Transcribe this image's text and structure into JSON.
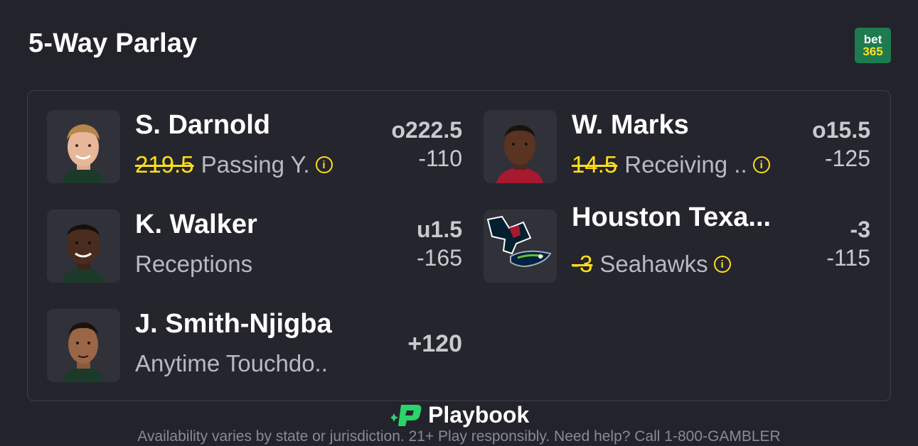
{
  "header": {
    "title": "5-Way Parlay",
    "logo_line1": "bet",
    "logo_line2": "365"
  },
  "legs": [
    {
      "player": "S. Darnold",
      "strike": "219.5",
      "market": "Passing Y.",
      "line": "o222.5",
      "odds": "-110",
      "avatar": "player-photo"
    },
    {
      "player": "W. Marks",
      "strike": "14.5",
      "market": "Receiving ..",
      "line": "o15.5",
      "odds": "-125",
      "avatar": "player-photo"
    },
    {
      "player": "K. Walker",
      "market": "Receptions",
      "line": "u1.5",
      "odds": "-165",
      "avatar": "player-photo"
    },
    {
      "player": "Houston Texa...",
      "strike": "-3",
      "market": "Seahawks",
      "line": "-3",
      "odds": "-115",
      "avatar": "team-logos"
    },
    {
      "player": "J. Smith-Njigba",
      "market": "Anytime Touchdo..",
      "odds": "+120",
      "avatar": "player-photo"
    }
  ],
  "footer": {
    "brand": "Playbook",
    "disclaimer": "Availability varies by state or jurisdiction. 21+ Play responsibly. Need help? Call 1-800-GAMBLER"
  },
  "colors": {
    "background": "#23232b",
    "accent_yellow": "#ffdf1b",
    "brand_green": "#1d7b4f",
    "playbook_green": "#2bd46b"
  }
}
